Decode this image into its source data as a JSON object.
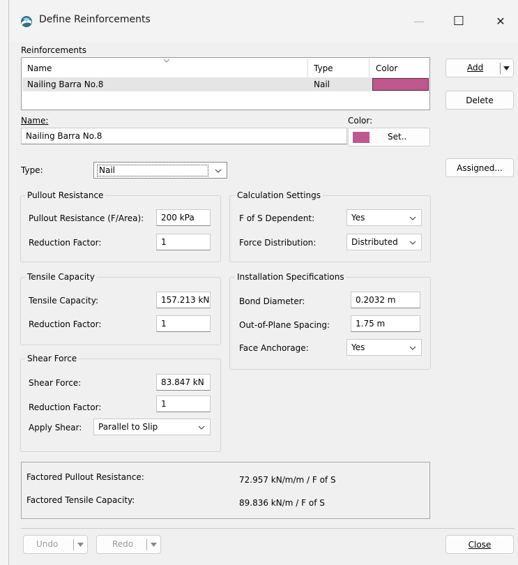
{
  "window": {
    "title": "Define Reinforcements",
    "minimize": "—",
    "maximize": "☐",
    "close": "✕"
  },
  "reinforcements": {
    "group_label": "Reinforcements",
    "columns": {
      "name": "Name",
      "type": "Type",
      "color": "Color"
    },
    "rows": [
      {
        "name": "Nailing Barra No.8",
        "type": "Nail",
        "color": "#c0588f"
      }
    ]
  },
  "buttons": {
    "add": "Add",
    "delete": "Delete",
    "assigned": "Assigned...",
    "set": "Set..",
    "undo": "Undo",
    "redo": "Redo",
    "close": "Close"
  },
  "name_field": {
    "label": "Name:",
    "value": "Nailing Barra No.8"
  },
  "color_field": {
    "label": "Color:",
    "value": "#c0588f"
  },
  "type_field": {
    "label": "Type:",
    "value": "Nail"
  },
  "pullout": {
    "title": "Pullout Resistance",
    "resistance_label": "Pullout Resistance (F/Area):",
    "resistance_value": "200 kPa",
    "reduction_label": "Reduction Factor:",
    "reduction_value": "1"
  },
  "tensile": {
    "title": "Tensile Capacity",
    "capacity_label": "Tensile Capacity:",
    "capacity_value": "157.213 kN",
    "reduction_label": "Reduction Factor:",
    "reduction_value": "1"
  },
  "shear": {
    "title": "Shear Force",
    "force_label": "Shear Force:",
    "force_value": "83.847 kN",
    "reduction_label": "Reduction Factor:",
    "reduction_value": "1",
    "apply_label": "Apply Shear:",
    "apply_value": "Parallel to Slip"
  },
  "calc": {
    "title": "Calculation Settings",
    "fos_label": "F of S Dependent:",
    "fos_value": "Yes",
    "dist_label": "Force Distribution:",
    "dist_value": "Distributed"
  },
  "install": {
    "title": "Installation Specifications",
    "bond_label": "Bond Diameter:",
    "bond_value": "0.2032 m",
    "spacing_label": "Out-of-Plane Spacing:",
    "spacing_value": "1.75 m",
    "anchor_label": "Face Anchorage:",
    "anchor_value": "Yes"
  },
  "summary": {
    "pullout_label": "Factored Pullout Resistance:",
    "pullout_value": "72.957 kN/m/m / F of S",
    "tensile_label": "Factored Tensile Capacity:",
    "tensile_value": "89.836 kN/m / F of S"
  }
}
